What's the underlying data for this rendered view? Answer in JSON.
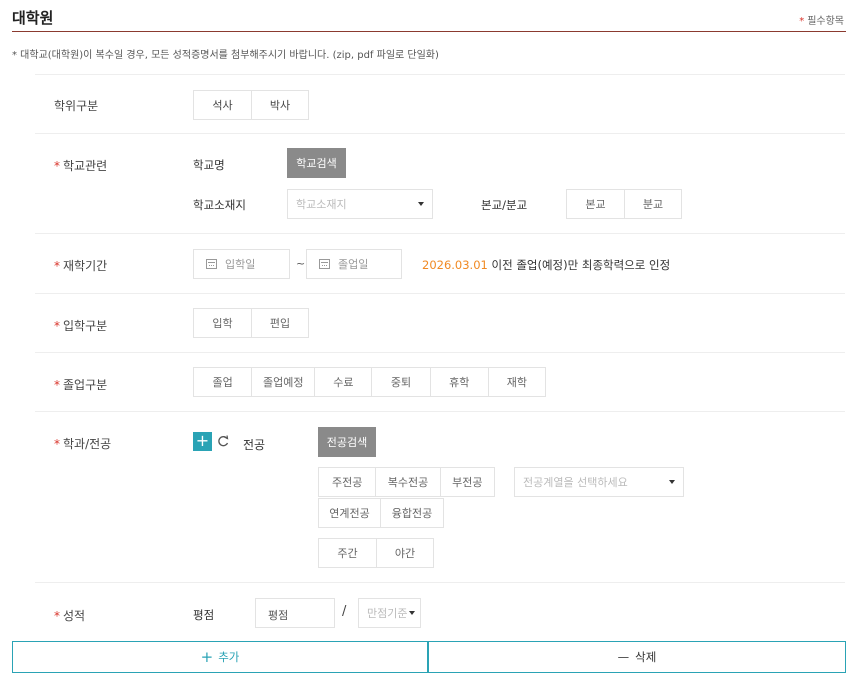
{
  "header": {
    "title": "대학원",
    "required_note": "필수항목",
    "required_mark": "*"
  },
  "notice": "* 대학교(대학원)이 복수일 경우, 모든 성적증명서를 첨부해주시기 바랍니다. (zip, pdf 파일로 단일화)",
  "degree": {
    "label": "학위구분",
    "options": [
      "석사",
      "박사"
    ]
  },
  "school": {
    "label": "학교관련",
    "name_label": "학교명",
    "search_button": "학교검색",
    "location_label": "학교소재지",
    "location_placeholder": "학교소재지",
    "branch_label": "본교/분교",
    "branch_options": [
      "본교",
      "분교"
    ]
  },
  "period": {
    "label": "재학기간",
    "start_placeholder": "입학일",
    "separator": "~",
    "end_placeholder": "졸업일",
    "note_date": "2026.03.01",
    "note_text": " 이전 졸업(예정)만 최종학력으로 인정"
  },
  "admission": {
    "label": "입학구분",
    "options": [
      "입학",
      "편입"
    ]
  },
  "graduation": {
    "label": "졸업구분",
    "options": [
      "졸업",
      "졸업예정",
      "수료",
      "중퇴",
      "휴학",
      "재학"
    ]
  },
  "major": {
    "label": "학과/전공",
    "add_icon": "+",
    "text": "전공",
    "search_button": "전공검색",
    "type_options_row1": [
      "주전공",
      "복수전공",
      "부전공"
    ],
    "type_options_row2": [
      "연계전공",
      "융합전공"
    ],
    "field_placeholder": "전공계열을 선택하세요",
    "time_options": [
      "주간",
      "야간"
    ]
  },
  "grades": {
    "label": "성적",
    "gpa_label": "평점",
    "gpa_placeholder": "평점",
    "slash": "/",
    "scale_placeholder": "만점기준"
  },
  "actions": {
    "add_icon": "+",
    "add_label": "추가",
    "delete_icon": "—",
    "delete_label": "삭제"
  },
  "colors": {
    "accent_teal": "#2aa3b5",
    "required_red": "#d9342b",
    "date_orange": "#f08a24"
  }
}
